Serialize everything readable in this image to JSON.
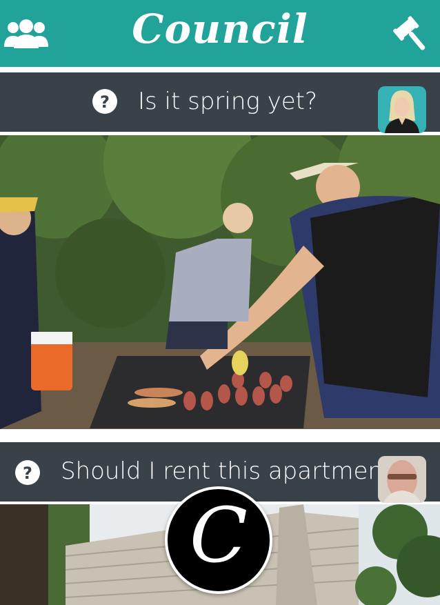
{
  "header": {
    "title": "Council",
    "left_icon": "group-icon",
    "right_icon": "gavel-icon",
    "color": "#22a39a"
  },
  "feed": {
    "items": [
      {
        "question": "Is it spring yet?",
        "icon": "question-icon",
        "photo": "barbecue-photo"
      },
      {
        "question": "Should I rent this apartment?",
        "icon": "question-icon",
        "photo": "building-photo"
      }
    ]
  },
  "fab": {
    "icon": "council-logo",
    "letter": "C"
  }
}
